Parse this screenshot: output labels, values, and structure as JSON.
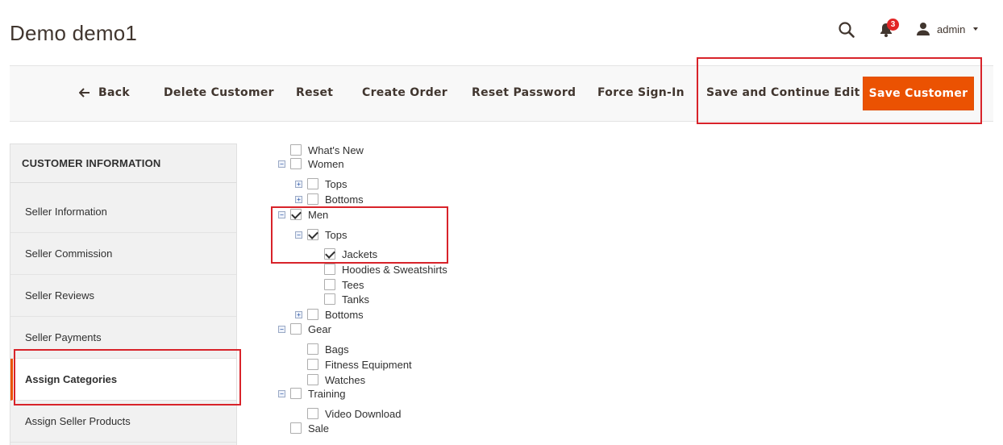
{
  "page": {
    "title": "Demo demo1"
  },
  "header": {
    "notifications_count": "3",
    "user": "admin"
  },
  "toolbar": {
    "back": "Back",
    "delete": "Delete Customer",
    "reset": "Reset",
    "create_order": "Create Order",
    "reset_password": "Reset Password",
    "force_signin": "Force Sign-In",
    "save_continue": "Save and Continue Edit",
    "save": "Save Customer"
  },
  "sidebar": {
    "heading": "CUSTOMER INFORMATION",
    "items": [
      {
        "label": "Seller Information"
      },
      {
        "label": "Seller Commission"
      },
      {
        "label": "Seller Reviews"
      },
      {
        "label": "Seller Payments"
      },
      {
        "label": "Assign Categories",
        "active": true
      },
      {
        "label": "Assign Seller Products"
      }
    ]
  },
  "tree": [
    {
      "label": "What's New",
      "checked": false,
      "toggle": ""
    },
    {
      "label": "Women",
      "checked": false,
      "toggle": "minus"
    },
    {
      "label": "Tops",
      "checked": false,
      "toggle": "plus"
    },
    {
      "label": "Bottoms",
      "checked": false,
      "toggle": "plus"
    },
    {
      "label": "Men",
      "checked": true,
      "toggle": "minus"
    },
    {
      "label": "Tops",
      "checked": true,
      "toggle": "minus"
    },
    {
      "label": "Jackets",
      "checked": true,
      "toggle": ""
    },
    {
      "label": "Hoodies & Sweatshirts",
      "checked": false,
      "toggle": ""
    },
    {
      "label": "Tees",
      "checked": false,
      "toggle": ""
    },
    {
      "label": "Tanks",
      "checked": false,
      "toggle": ""
    },
    {
      "label": "Bottoms",
      "checked": false,
      "toggle": "plus"
    },
    {
      "label": "Gear",
      "checked": false,
      "toggle": "minus"
    },
    {
      "label": "Bags",
      "checked": false,
      "toggle": ""
    },
    {
      "label": "Fitness Equipment",
      "checked": false,
      "toggle": ""
    },
    {
      "label": "Watches",
      "checked": false,
      "toggle": ""
    },
    {
      "label": "Training",
      "checked": false,
      "toggle": "minus"
    },
    {
      "label": "Video Download",
      "checked": false,
      "toggle": ""
    },
    {
      "label": "Sale",
      "checked": false,
      "toggle": ""
    }
  ],
  "colors": {
    "accent": "#eb5202",
    "highlight": "#d8232a",
    "badge": "#e22626"
  }
}
